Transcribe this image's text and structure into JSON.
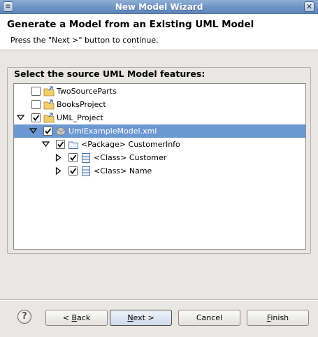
{
  "window": {
    "title": "New Model Wizard",
    "close_glyph": "✕"
  },
  "header": {
    "title": "Generate a Model from an Existing UML Model",
    "message": "Press the \"Next >\" button to continue."
  },
  "group_label": "Select the source UML Model features:",
  "tree": {
    "items": [
      {
        "label": "TwoSourceParts",
        "checked": false,
        "icon": "project-folder-icon"
      },
      {
        "label": "BooksProject",
        "checked": false,
        "icon": "project-folder-icon"
      },
      {
        "label": "UML_Project",
        "checked": true,
        "expanded": true,
        "icon": "project-folder-icon"
      },
      {
        "label": "UmlExampleModel.xmi",
        "checked": true,
        "expanded": true,
        "selected": true,
        "icon": "model-file-icon"
      },
      {
        "label": "<Package> CustomerInfo",
        "checked": true,
        "expanded": true,
        "icon": "package-folder-icon"
      },
      {
        "label": "<Class> Customer",
        "checked": true,
        "expanded": false,
        "icon": "class-icon"
      },
      {
        "label": "<Class> Name",
        "checked": true,
        "expanded": false,
        "icon": "class-icon"
      }
    ]
  },
  "buttons": {
    "help_glyph": "?",
    "back": {
      "mnemonic": "B",
      "rest": "ack",
      "prefix": "< "
    },
    "next": {
      "mnemonic": "N",
      "rest": "ext >"
    },
    "cancel": "Cancel",
    "finish": {
      "mnemonic": "F",
      "rest": "inish"
    }
  }
}
